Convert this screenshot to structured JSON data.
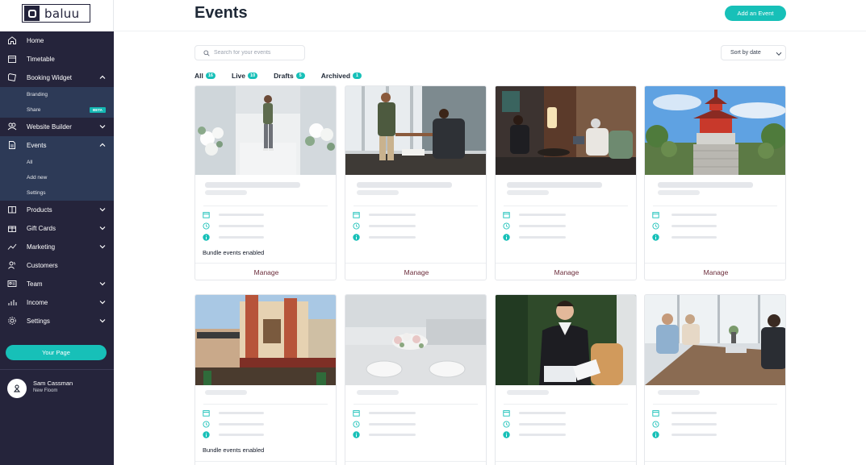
{
  "brand": {
    "logo_text": "baluu",
    "accent": "#17c0b8",
    "sidebar_bg": "#25243b"
  },
  "sidebar": {
    "items": [
      {
        "label": "Home",
        "icon": "home-icon"
      },
      {
        "label": "Timetable",
        "icon": "calendar-icon"
      },
      {
        "label": "Booking Widget",
        "icon": "tag-icon",
        "expanded": true,
        "children": [
          {
            "label": "Branding"
          },
          {
            "label": "Share",
            "badge": "BETA"
          }
        ]
      },
      {
        "label": "Website Builder",
        "icon": "globe-icon"
      },
      {
        "label": "Events",
        "icon": "document-icon",
        "expanded": true,
        "children": [
          {
            "label": "All"
          },
          {
            "label": "Add new"
          },
          {
            "label": "Settings"
          }
        ]
      },
      {
        "label": "Products",
        "icon": "box-icon"
      },
      {
        "label": "Gift Cards",
        "icon": "gift-icon"
      },
      {
        "label": "Marketing",
        "icon": "trend-icon"
      },
      {
        "label": "Customers",
        "icon": "users-icon"
      },
      {
        "label": "Team",
        "icon": "id-card-icon"
      },
      {
        "label": "Income",
        "icon": "bar-chart-icon"
      },
      {
        "label": "Settings",
        "icon": "gear-icon"
      }
    ],
    "your_page": "Your Page",
    "user": {
      "name": "Sam Cassman",
      "subtitle": "New Floom"
    }
  },
  "header": {
    "title": "Events",
    "add_button": "Add an Event"
  },
  "toolbar": {
    "search_placeholder": "Search for your events",
    "sort_label": "Sort by date"
  },
  "tabs": [
    {
      "label": "All",
      "count": "16"
    },
    {
      "label": "Live",
      "count": "10"
    },
    {
      "label": "Drafts",
      "count": "5"
    },
    {
      "label": "Archived",
      "count": "1"
    }
  ],
  "cards": [
    {
      "image": "fashion-runway-photo",
      "bundle": "Bundle events enabled",
      "action": "Manage"
    },
    {
      "image": "business-handshake-photo",
      "bundle": "",
      "action": "Manage"
    },
    {
      "image": "lounge-meeting-photo",
      "bundle": "",
      "action": "Manage"
    },
    {
      "image": "japanese-temple-photo",
      "bundle": "",
      "action": "Manage"
    },
    {
      "image": "theatre-building-photo",
      "bundle": "Bundle events enabled",
      "action": "Manage"
    },
    {
      "image": "wedding-table-photo",
      "bundle": "",
      "action": "Manage"
    },
    {
      "image": "man-reading-document-photo",
      "bundle": "",
      "action": "Manage"
    },
    {
      "image": "office-meeting-photo",
      "bundle": "",
      "action": "Manage"
    }
  ]
}
